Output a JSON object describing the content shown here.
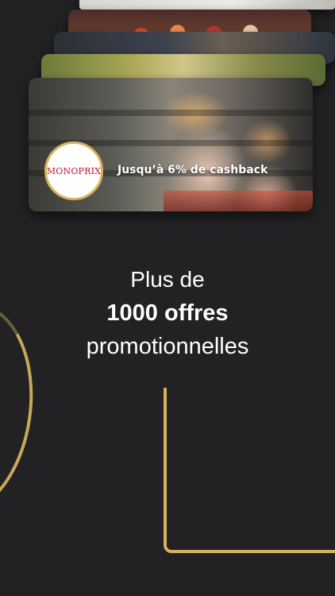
{
  "offer_card": {
    "brand_logo_text": "MONOPRIX",
    "cashback_text": "Jusqu’à 6% de cashback"
  },
  "headline": {
    "line1": "Plus de",
    "line2": "1000 offres",
    "line3": "promotionnelles"
  },
  "colors": {
    "background": "#222124",
    "accent_gold": "#d4b35d",
    "brand_red": "#c8102e"
  }
}
